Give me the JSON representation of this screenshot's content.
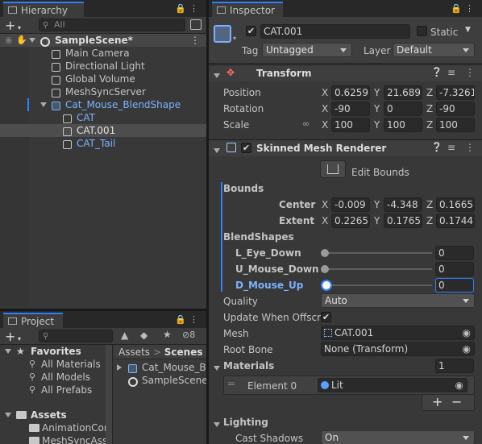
{
  "hierarchy": {
    "tab": "Hierarchy",
    "search_placeholder": "All",
    "add_label": "+",
    "scene": "SampleScene*",
    "items": [
      "Main Camera",
      "Directional Light",
      "Global Volume",
      "MeshSyncServer",
      "Cat_Mouse_BlendShape",
      "CAT",
      "CAT.001",
      "CAT_Tail"
    ]
  },
  "project": {
    "tab": "Project",
    "add_label": "+",
    "hidden_count": "8",
    "favorites": {
      "title": "Favorites",
      "items": [
        "All Materials",
        "All Models",
        "All Prefabs"
      ]
    },
    "assets": {
      "title": "Assets",
      "items": [
        "AnimationCor",
        "MeshSyncAss"
      ]
    },
    "breadcrumb": [
      "Assets",
      "Scenes"
    ],
    "files": [
      "Cat_Mouse_Bl",
      "SampleScene"
    ]
  },
  "inspector": {
    "tab": "Inspector",
    "object_name": "CAT.001",
    "static_label": "Static",
    "tag_label": "Tag",
    "tag_value": "Untagged",
    "layer_label": "Layer",
    "layer_value": "Default",
    "transform": {
      "title": "Transform",
      "rows": [
        {
          "label": "Position",
          "x": "0.6259",
          "y": "21.6893",
          "z": "-7.3261"
        },
        {
          "label": "Rotation",
          "x": "-90",
          "y": "0",
          "z": "-90"
        },
        {
          "label": "Scale",
          "x": "100",
          "y": "100",
          "z": "100"
        }
      ]
    },
    "smr": {
      "title": "Skinned Mesh Renderer",
      "edit_bounds": "Edit Bounds",
      "bounds_label": "Bounds",
      "center_label": "Center",
      "center": {
        "x": "-0.009",
        "y": "-4.348",
        "z": "0.1665"
      },
      "extent_label": "Extent",
      "extent": {
        "x": "0.2265",
        "y": "0.1765",
        "z": "0.1744"
      },
      "blendshapes_label": "BlendShapes",
      "blendshapes": [
        {
          "name": "L_Eye_Down",
          "value": "0"
        },
        {
          "name": "U_Mouse_Down",
          "value": "0"
        },
        {
          "name": "D_Mouse_Up",
          "value": "0"
        }
      ],
      "quality_label": "Quality",
      "quality_value": "Auto",
      "update_offscreen_label": "Update When Offscre",
      "mesh_label": "Mesh",
      "mesh_value": "CAT.001",
      "root_bone_label": "Root Bone",
      "root_bone_value": "None (Transform)",
      "materials_label": "Materials",
      "materials_count": "1",
      "element_label": "Element 0",
      "element_value": "Lit",
      "lighting_label": "Lighting",
      "cast_shadows_label": "Cast Shadows",
      "cast_shadows_value": "On"
    },
    "axis": {
      "x": "X",
      "y": "Y",
      "z": "Z"
    }
  },
  "colors": {
    "accent": "#2f7fff",
    "prefab_blue": "#7ab2ff"
  }
}
